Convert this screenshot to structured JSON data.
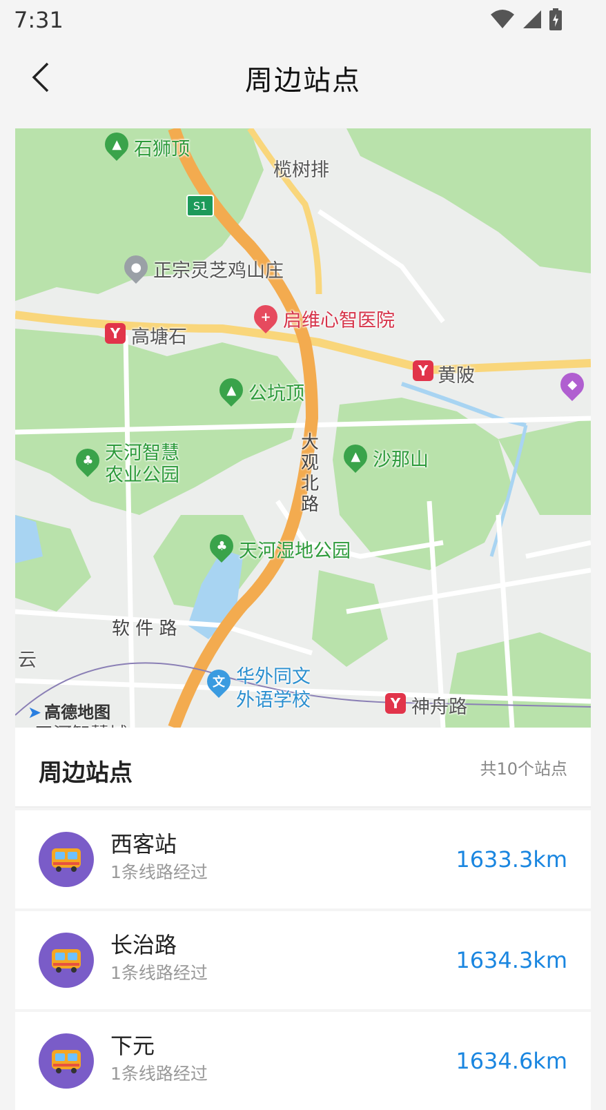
{
  "status": {
    "time": "7:31"
  },
  "header": {
    "title": "周边站点"
  },
  "map": {
    "pois": {
      "shishiding": "石狮顶",
      "lanshupai": "榄树排",
      "s1": "S1",
      "lingzhi": "正宗灵芝鸡山庄",
      "hospital": "启维心智医院",
      "gaotangshi": "高塘石",
      "huangpi": "黄陂",
      "gongkengding": "公坑顶",
      "tianhe_park_1": "天河智慧",
      "tianhe_park_2": "农业公园",
      "dagaun_road": "大观北路",
      "shanashan": "沙那山",
      "wetland": "天河湿地公园",
      "software_road": "软 件 路",
      "yun": "云",
      "school_1": "华外同文",
      "school_2": "外语学校",
      "shenzhou": "神舟路",
      "tianhe_city": "天河智慧城"
    },
    "logo": "高德地图"
  },
  "list": {
    "title": "周边站点",
    "count": "共10个站点",
    "stations": [
      {
        "name": "西客站",
        "lines": "1条线路经过",
        "distance": "1633.3km"
      },
      {
        "name": "长治路",
        "lines": "1条线路经过",
        "distance": "1634.3km"
      },
      {
        "name": "下元",
        "lines": "1条线路经过",
        "distance": "1634.6km"
      }
    ]
  },
  "colors": {
    "accent": "#1a86e0",
    "avatar": "#7a5cc8",
    "park": "#b6e3a7",
    "highway": "#f5b35a"
  }
}
